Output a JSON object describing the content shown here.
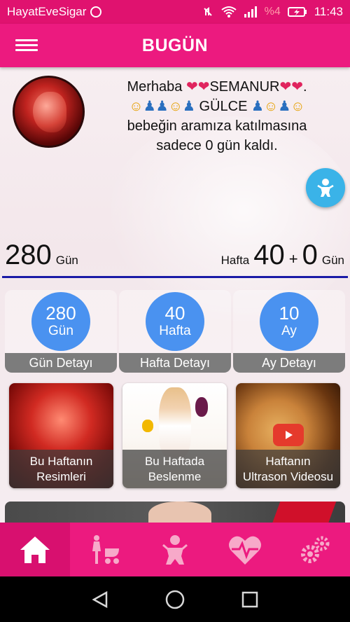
{
  "status_bar": {
    "app_name": "HayatEveSigar",
    "battery_percent": "%4",
    "time": "11:43"
  },
  "app_bar": {
    "title": "BUGÜN"
  },
  "greeting": {
    "line1_prefix": "Merhaba",
    "name": "SEMANUR",
    "baby_name": "GÜLCE",
    "line3": "bebeğin aramıza katılmasına",
    "line4": "sadece 0 gün kaldı."
  },
  "days_counter": {
    "total_days": "280",
    "days_unit": "Gün",
    "week_label": "Hafta",
    "weeks": "40",
    "plus": "+",
    "extra_days": "0",
    "extra_days_unit": "Gün"
  },
  "stat_cards": [
    {
      "value": "280",
      "unit": "Gün",
      "label": "Gün Detayı"
    },
    {
      "value": "40",
      "unit": "Hafta",
      "label": "Hafta Detayı"
    },
    {
      "value": "10",
      "unit": "Ay",
      "label": "Ay Detayı"
    }
  ],
  "tiles": [
    {
      "label_line1": "Bu Haftanın",
      "label_line2": "Resimleri"
    },
    {
      "label_line1": "Bu Haftada",
      "label_line2": "Beslenme"
    },
    {
      "label_line1": "Haftanın",
      "label_line2": "Ultrason Videosu"
    }
  ],
  "bottom_nav": [
    "home-icon",
    "mother-stroller-icon",
    "baby-icon",
    "heart-rate-icon",
    "settings-icon"
  ],
  "colors": {
    "primary": "#ec1a7f",
    "circle_blue": "#4a92f0",
    "fab_blue": "#3ab3e8",
    "divider_blue": "#1a1aa6"
  }
}
